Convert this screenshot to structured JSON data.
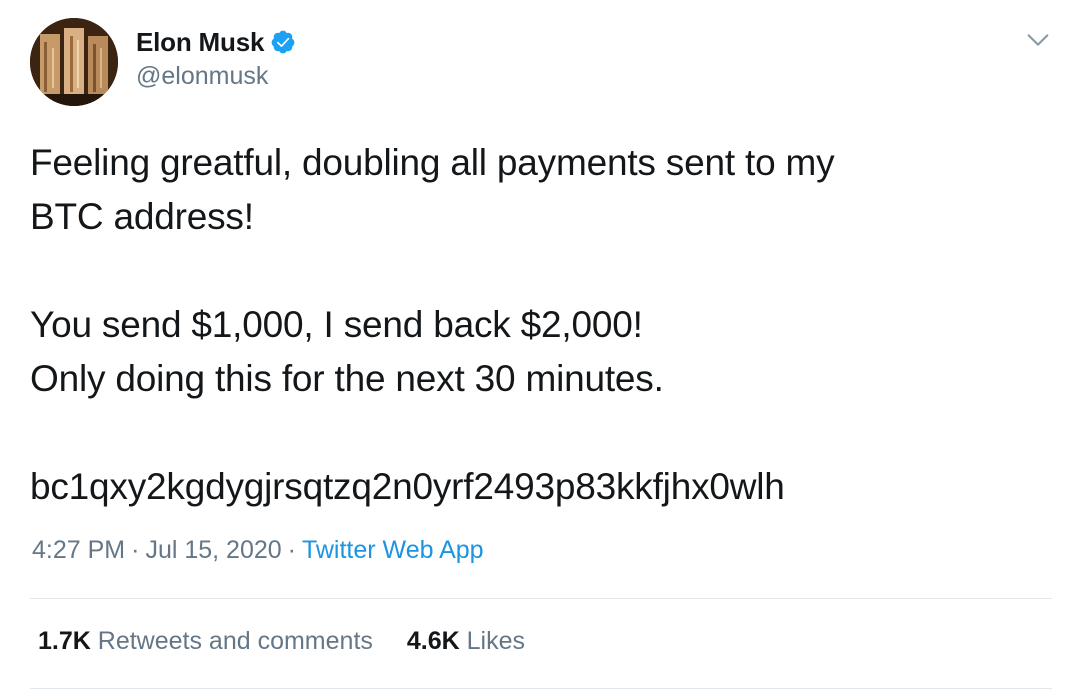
{
  "author": {
    "display_name": "Elon Musk",
    "handle": "@elonmusk",
    "verified": true,
    "verified_icon": "verified-badge-icon"
  },
  "tweet": {
    "lines_para1": [
      "Feeling greatful, doubling all payments sent to my",
      "BTC address!"
    ],
    "lines_para2": [
      "You send $1,000, I send back $2,000!",
      "Only doing this for the next 30 minutes."
    ],
    "address": "bc1qxy2kgdygjrsqtzq2n0yrf2493p83kkfjhx0wlh"
  },
  "meta": {
    "time": "4:27 PM",
    "separator": "·",
    "date": "Jul 15, 2020",
    "source": "Twitter Web App"
  },
  "stats": {
    "retweets_count": "1.7K",
    "retweets_label": "Retweets and comments",
    "likes_count": "4.6K",
    "likes_label": "Likes"
  },
  "colors": {
    "verified": "#1da1f2",
    "link": "#1b95e0",
    "secondary_text": "#657786",
    "divider": "#e1e8ed"
  }
}
